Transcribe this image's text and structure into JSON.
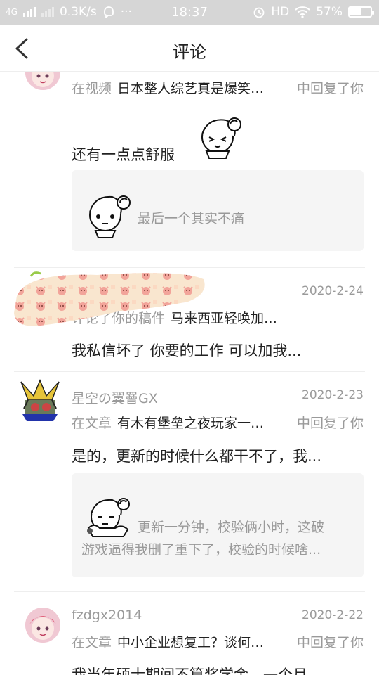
{
  "status_bar": {
    "network": "4G",
    "speed": "0.3K/s",
    "more": "···",
    "time": "18:37",
    "hd": "HD",
    "battery_percent": "57%",
    "battery_level": 0.57
  },
  "nav": {
    "back_icon": "chevron-left-icon",
    "title": "评论"
  },
  "comments": [
    {
      "context_prefix": "在视频",
      "context_link": "日本整人综艺真是爆笑…",
      "context_suffix": "中回复了你",
      "body": "还有一点点舒服",
      "quote": "最后一个其实不痛"
    },
    {
      "date": "2020-2-24",
      "context_prefix": "评论了你的稿件",
      "context_link": "马来西亚轻唤加…",
      "body": "我私信坏了 你要的工作 可以加我..."
    },
    {
      "name": "星空の翼罾GX",
      "date": "2020-2-23",
      "context_prefix": "在文章",
      "context_link": "有木有堡垒之夜玩家一…",
      "context_suffix": "中回复了你",
      "body": "是的，更新的时候什么都干不了，我...",
      "quote_line1": "更新一分钟，校验俩小时，这破",
      "quote_line2": "游戏逼得我删了重下了，校验的时候啥..."
    },
    {
      "name": "fzdgx2014",
      "date": "2020-2-22",
      "context_prefix": "在文章",
      "context_link": "中小企业想复工？谈何…",
      "context_suffix": "中回复了你",
      "body": "我当年硕士期间不算奖学金，一个月..."
    }
  ]
}
